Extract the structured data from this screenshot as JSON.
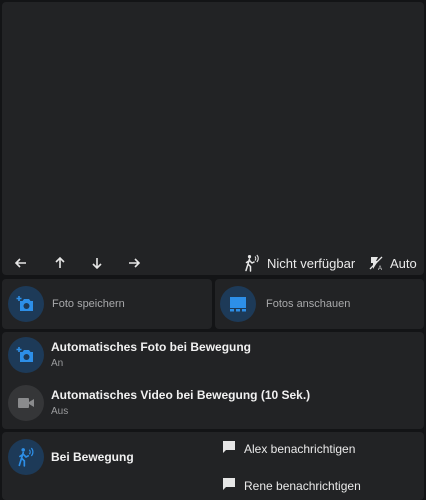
{
  "camera": {
    "controls": {
      "left_icon": "arrow-left-icon",
      "up_icon": "arrow-up-icon",
      "down_icon": "arrow-down-icon",
      "right_icon": "arrow-right-icon",
      "motion_status_label": "Nicht verfügbar",
      "motion_status_icon": "motion-sensor-icon",
      "mode_label": "Auto",
      "mode_icon": "auto-flash-icon"
    }
  },
  "actions": {
    "save_photo": {
      "label": "Foto speichern",
      "icon": "camera-plus-icon"
    },
    "view_photos": {
      "label": "Fotos anschauen",
      "icon": "gallery-icon"
    }
  },
  "automations": [
    {
      "title": "Automatisches Foto bei Bewegung",
      "state": "An",
      "icon": "camera-plus-icon"
    },
    {
      "title": "Automatisches Video bei Bewegung (10 Sek.)",
      "state": "Aus",
      "icon": "video-icon"
    }
  ],
  "motion": {
    "label": "Bei Bewegung",
    "icon": "motion-sensor-icon",
    "notifications": [
      {
        "label": "Alex benachrichtigen",
        "icon": "message-icon"
      },
      {
        "label": "Rene benachrichtigen",
        "icon": "message-icon"
      }
    ]
  },
  "colors": {
    "background": "#131416",
    "card": "#222325",
    "accent": "#2d8fe8",
    "accent_circle": "#1d3a58",
    "muted_circle": "#353638"
  }
}
